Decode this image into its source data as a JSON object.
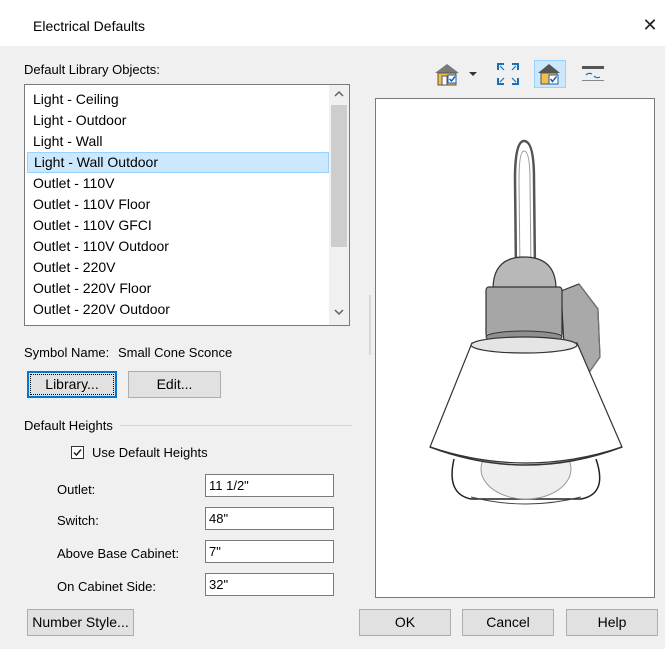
{
  "window": {
    "title": "Electrical Defaults",
    "close_glyph": "✕"
  },
  "library": {
    "heading": "Default Library Objects:",
    "items": [
      "Light - Ceiling",
      "Light - Outdoor",
      "Light - Wall",
      "Light - Wall Outdoor",
      "Outlet - 110V",
      "Outlet - 110V Floor",
      "Outlet - 110V GFCI",
      "Outlet - 110V Outdoor",
      "Outlet - 220V",
      "Outlet - 220V Floor",
      "Outlet - 220V Outdoor"
    ],
    "selected_index": 3
  },
  "symbol": {
    "label": "Symbol Name:",
    "value": "Small Cone Sconce"
  },
  "buttons": {
    "library": "Library...",
    "edit": "Edit...",
    "number_style": "Number Style...",
    "ok": "OK",
    "cancel": "Cancel",
    "help": "Help"
  },
  "heights": {
    "heading": "Default Heights",
    "use_default_label": "Use Default Heights",
    "use_default_checked": true,
    "rows": [
      {
        "label": "Outlet:",
        "value": "11 1/2\""
      },
      {
        "label": "Switch:",
        "value": "48\""
      },
      {
        "label": "Above Base Cabinet:",
        "value": "7\""
      },
      {
        "label": "On Cabinet Side:",
        "value": "32\""
      }
    ]
  },
  "toolbar": {
    "icons": [
      "camera-view-icon",
      "dropdown-arrow-icon",
      "fill-window-icon",
      "render-mode-icon",
      "rotate-icon"
    ]
  },
  "colors": {
    "accent": "#0078d7",
    "selection": "#cce8ff"
  }
}
